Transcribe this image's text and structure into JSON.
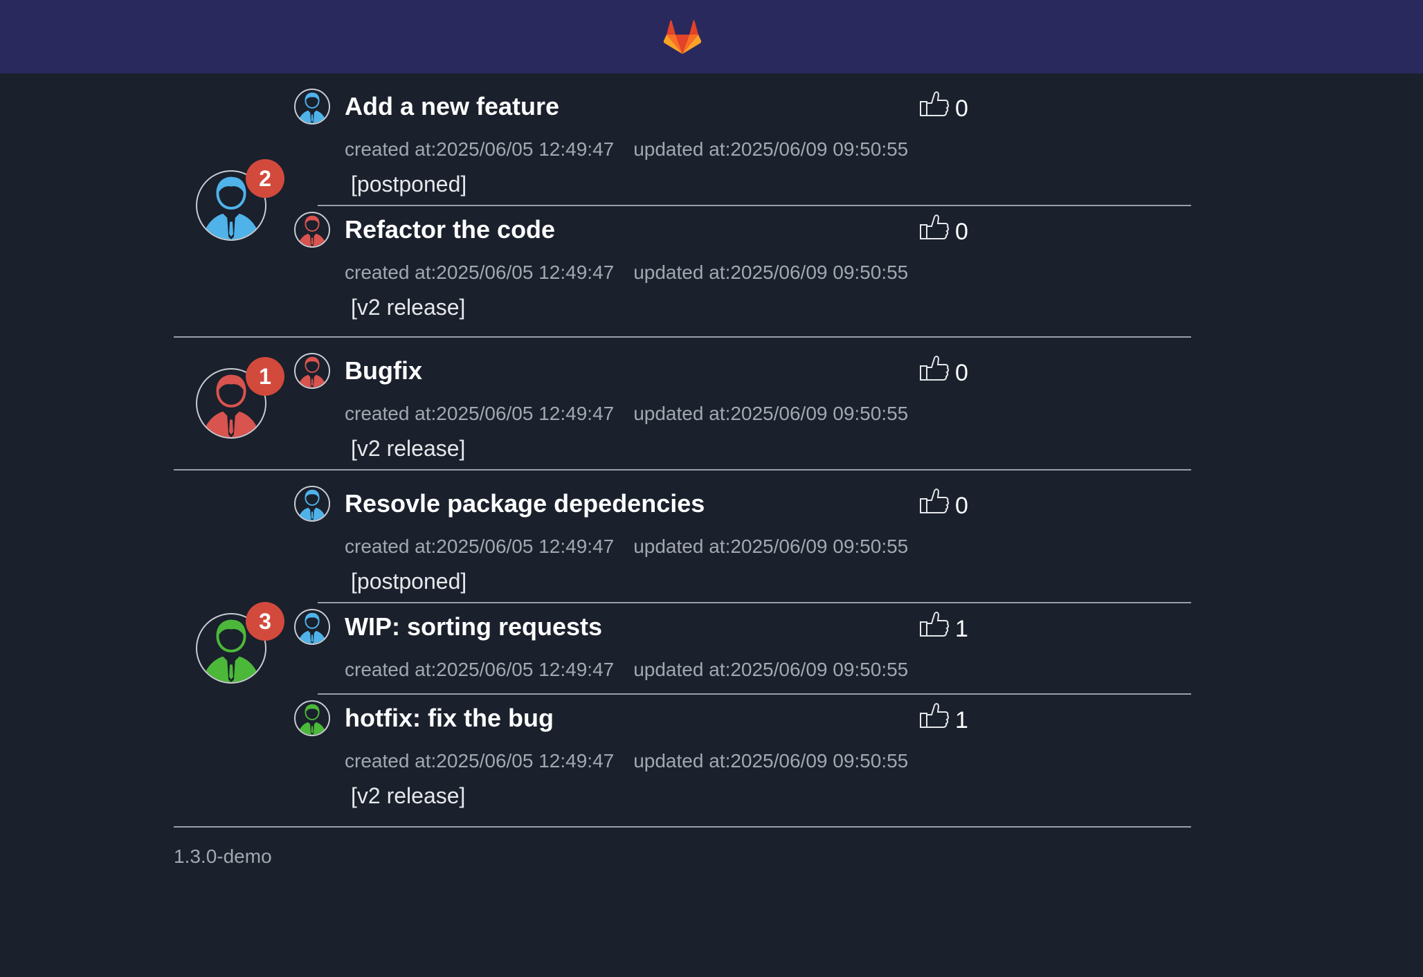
{
  "header": {
    "logo_icon": "gitlab-tanuki-icon",
    "background": "#29295e"
  },
  "colors": {
    "blue": "#4fb3ea",
    "red": "#d9534f",
    "green": "#4cb83a",
    "badge": "#d24a3c"
  },
  "groups": [
    {
      "badge": "2",
      "avatar_color": "blue",
      "merge_requests": [
        {
          "title": "Add a new feature",
          "votes": "0",
          "created": "created at:2025/06/05 12:49:47",
          "updated": "updated at:2025/06/09 09:50:55",
          "milestone": "[postponed]",
          "author_color": "blue"
        },
        {
          "title": "Refactor the code",
          "votes": "0",
          "created": "created at:2025/06/05 12:49:47",
          "updated": "updated at:2025/06/09 09:50:55",
          "milestone": "[v2 release]",
          "author_color": "red"
        }
      ]
    },
    {
      "badge": "1",
      "avatar_color": "red",
      "merge_requests": [
        {
          "title": "Bugfix",
          "votes": "0",
          "created": "created at:2025/06/05 12:49:47",
          "updated": "updated at:2025/06/09 09:50:55",
          "milestone": "[v2 release]",
          "author_color": "red"
        }
      ]
    },
    {
      "badge": "3",
      "avatar_color": "green",
      "merge_requests": [
        {
          "title": "Resovle package depedencies",
          "votes": "0",
          "created": "created at:2025/06/05 12:49:47",
          "updated": "updated at:2025/06/09 09:50:55",
          "milestone": "[postponed]",
          "author_color": "blue"
        },
        {
          "title": "WIP: sorting requests",
          "votes": "1",
          "created": "created at:2025/06/05 12:49:47",
          "updated": "updated at:2025/06/09 09:50:55",
          "milestone": "",
          "author_color": "blue"
        },
        {
          "title": "hotfix: fix the bug",
          "votes": "1",
          "created": "created at:2025/06/05 12:49:47",
          "updated": "updated at:2025/06/09 09:50:55",
          "milestone": "[v2 release]",
          "author_color": "green"
        }
      ]
    }
  ],
  "footer": {
    "version": "1.3.0-demo"
  }
}
